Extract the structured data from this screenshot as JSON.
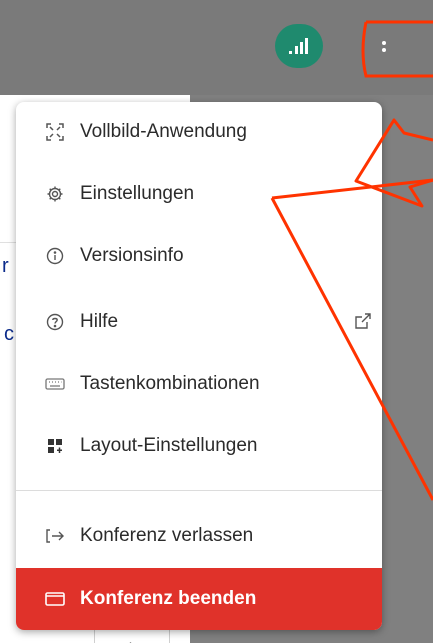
{
  "colors": {
    "accent_green": "#1f8a6e",
    "danger": "#e0322a",
    "annotation": "#ff3300"
  },
  "icons": {
    "signal": "signal-bars-icon",
    "more": "more-vertical-icon"
  },
  "menu": {
    "items": [
      {
        "label": "Vollbild-Anwendung",
        "icon": "fullscreen-icon"
      },
      {
        "label": "Einstellungen",
        "icon": "gear-icon"
      },
      {
        "label": "Versionsinfo",
        "icon": "info-icon"
      },
      {
        "label": "Hilfe",
        "icon": "help-icon",
        "trailing_icon": "external-link-icon"
      },
      {
        "label": "Tastenkombinationen",
        "icon": "keyboard-icon"
      },
      {
        "label": "Layout-Einstellungen",
        "icon": "layout-icon"
      },
      {
        "label": "Konferenz verlassen",
        "icon": "leave-icon"
      },
      {
        "label": "Konferenz beenden",
        "icon": "end-meeting-icon"
      }
    ]
  },
  "background": {
    "fragment_1": "r",
    "fragment_2": "c"
  }
}
